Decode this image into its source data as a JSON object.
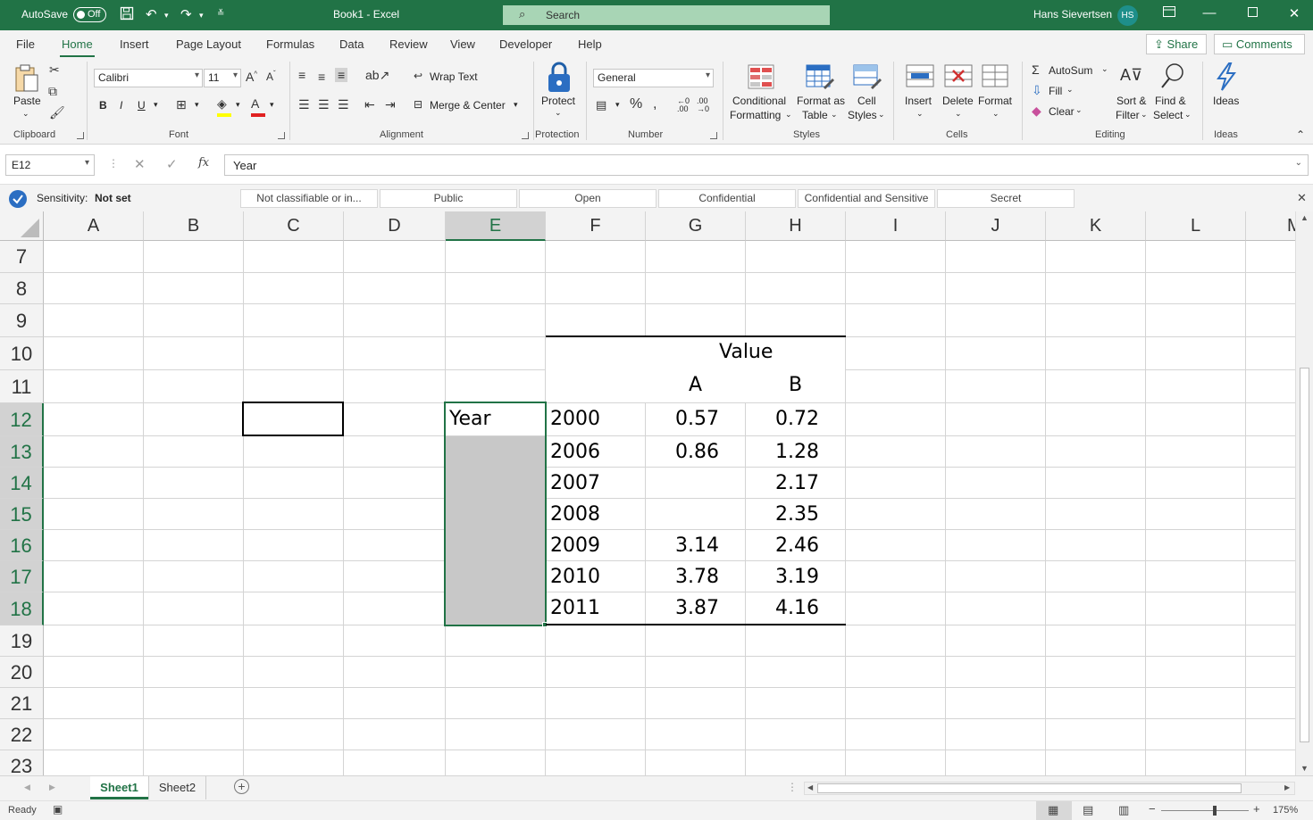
{
  "titlebar": {
    "autosave_label": "AutoSave",
    "autosave_state": "Off",
    "doc_title": "Book1  -  Excel",
    "search_placeholder": "Search",
    "user_name": "Hans Sievertsen",
    "user_initials": "HS"
  },
  "menu": {
    "tabs": [
      "File",
      "Home",
      "Insert",
      "Page Layout",
      "Formulas",
      "Data",
      "Review",
      "View",
      "Developer",
      "Help"
    ],
    "active_tab": "Home",
    "share_label": "Share",
    "comments_label": "Comments"
  },
  "ribbon": {
    "clipboard": {
      "paste": "Paste",
      "label": "Clipboard"
    },
    "font": {
      "name": "Calibri",
      "size": "11",
      "bold": "B",
      "italic": "I",
      "underline": "U",
      "label": "Font"
    },
    "alignment": {
      "wrap_text": "Wrap Text",
      "merge_center": "Merge & Center",
      "label": "Alignment"
    },
    "protection": {
      "protect": "Protect",
      "label": "Protection"
    },
    "number": {
      "format": "General",
      "label": "Number"
    },
    "styles": {
      "conditional_1": "Conditional",
      "conditional_2": "Formatting",
      "format_table_1": "Format as",
      "format_table_2": "Table",
      "cell_styles_1": "Cell",
      "cell_styles_2": "Styles",
      "label": "Styles"
    },
    "cells": {
      "insert": "Insert",
      "delete": "Delete",
      "format": "Format",
      "label": "Cells"
    },
    "editing": {
      "autosum": "AutoSum",
      "fill": "Fill",
      "clear": "Clear",
      "sort_1": "Sort &",
      "sort_2": "Filter",
      "find_1": "Find &",
      "find_2": "Select",
      "label": "Editing"
    },
    "ideas": {
      "ideas": "Ideas",
      "label": "Ideas"
    }
  },
  "formula_bar": {
    "name_box": "E12",
    "fx": "fx",
    "formula": "Year"
  },
  "sensitivity": {
    "label": "Sensitivity:",
    "value": "Not set",
    "options": [
      "Not classifiable or in...",
      "Public",
      "Open",
      "Confidential",
      "Confidential and Sensitive",
      "Secret"
    ]
  },
  "grid": {
    "columns": [
      "A",
      "B",
      "C",
      "D",
      "E",
      "F",
      "G",
      "H",
      "I",
      "J",
      "K",
      "L",
      "M"
    ],
    "selected_column": "E",
    "rows": [
      "7",
      "8",
      "9",
      "10",
      "11",
      "12",
      "13",
      "14",
      "15",
      "16",
      "17",
      "18",
      "19",
      "20",
      "21",
      "22",
      "23"
    ],
    "selected_rows": [
      "12",
      "13",
      "14",
      "15",
      "16",
      "17",
      "18"
    ],
    "table": {
      "value_header": "Value",
      "subheader_a": "A",
      "subheader_b": "B",
      "year_label": "Year",
      "data": [
        {
          "year": "2000",
          "a": "0.57",
          "b": "0.72"
        },
        {
          "year": "2006",
          "a": "0.86",
          "b": "1.28"
        },
        {
          "year": "2007",
          "a": "",
          "b": "2.17"
        },
        {
          "year": "2008",
          "a": "",
          "b": "2.35"
        },
        {
          "year": "2009",
          "a": "3.14",
          "b": "2.46"
        },
        {
          "year": "2010",
          "a": "3.78",
          "b": "3.19"
        },
        {
          "year": "2011",
          "a": "3.87",
          "b": "4.16"
        }
      ]
    }
  },
  "sheets": {
    "tabs": [
      "Sheet1",
      "Sheet2"
    ],
    "active": "Sheet1"
  },
  "status": {
    "ready": "Ready",
    "zoom": "175%"
  },
  "colors": {
    "excel_green": "#217346",
    "selection_fill": "#c8c8c8"
  }
}
